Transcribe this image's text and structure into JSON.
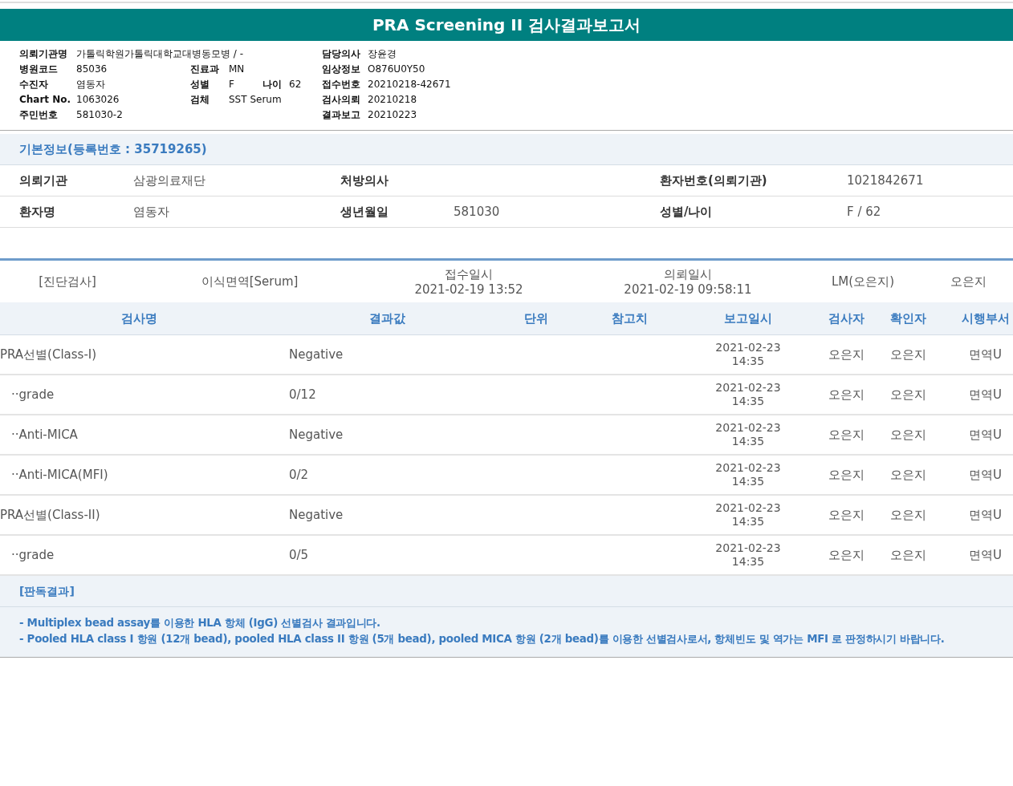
{
  "title": "PRA Screening II 검사결과보고서",
  "header_info": [
    {
      "col1": {
        "label": "의뢰기관명",
        "value": "가톨릭학원가톨릭대학교대병동모병 / -"
      },
      "col4": {
        "label": "담당의사",
        "value": "장윤경"
      }
    },
    {
      "col1": {
        "label": "병원코드",
        "value": "85036"
      },
      "col2": {
        "label": "진료과",
        "value": "MN"
      },
      "col4": {
        "label": "임상정보",
        "value": "O876U0Y50"
      }
    },
    {
      "col1": {
        "label": "수진자",
        "value": "염동자"
      },
      "col2": {
        "label": "성별",
        "value": "F"
      },
      "col3": {
        "label": "나이",
        "value": "62"
      },
      "col4": {
        "label": "접수번호",
        "value": "20210218-42671"
      }
    },
    {
      "col1": {
        "label": "Chart No.",
        "value": "1063026"
      },
      "col2": {
        "label": "검체",
        "value": "SST Serum"
      },
      "col4": {
        "label": "검사의뢰",
        "value": "20210218"
      }
    },
    {
      "col1": {
        "label": "주민번호",
        "value": "581030-2"
      },
      "col4": {
        "label": "결과보고",
        "value": "20210223"
      }
    }
  ],
  "basic_info": {
    "title": "기본정보(등록번호 : 35719265)",
    "rows": [
      [
        {
          "label": "의뢰기관",
          "value": "삼광의료재단"
        },
        {
          "label": "처방의사"
        },
        {
          "label": "환자번호(의뢰기관)",
          "value": "1021842671"
        }
      ],
      [
        {
          "label": "환자명",
          "value": "염동자"
        },
        {
          "label": "생년월일",
          "value": "581030"
        },
        {
          "label": "성별/나이",
          "value": "F / 62"
        }
      ]
    ]
  },
  "order": {
    "category": "[진단검사]",
    "department": "이식면역[Serum]",
    "received_label": "접수일시",
    "received": "2021-02-19 13:52",
    "requested_label": "의뢰일시",
    "requested": "2021-02-19 09:58:11",
    "lab": "LM(오은지)",
    "person": "오은지"
  },
  "results": {
    "columns": [
      "검사명",
      "결과값",
      "단위",
      "참고치",
      "보고일시",
      "검사자",
      "확인자",
      "시행부서"
    ],
    "rows": [
      {
        "name": "PRA선별(Class-I)",
        "result": "Negative",
        "reported": "2021-02-23\n14:35",
        "tester": "오은지",
        "confirmer": "오은지",
        "dept": "면역U",
        "children": [
          {
            "name": "··grade",
            "result": "0/12",
            "reported": "2021-02-23\n14:35",
            "tester": "오은지",
            "confirmer": "오은지",
            "dept": "면역U"
          },
          {
            "name": "··Anti-MICA",
            "result": "Negative",
            "reported": "2021-02-23\n14:35",
            "tester": "오은지",
            "confirmer": "오은지",
            "dept": "면역U"
          },
          {
            "name": "··Anti-MICA(MFI)",
            "result": "0/2",
            "reported": "2021-02-23\n14:35",
            "tester": "오은지",
            "confirmer": "오은지",
            "dept": "면역U"
          }
        ]
      },
      {
        "name": "PRA선별(Class-II)",
        "result": "Negative",
        "reported": "2021-02-23\n14:35",
        "tester": "오은지",
        "confirmer": "오은지",
        "dept": "면역U",
        "children": [
          {
            "name": "··grade",
            "result": "0/5",
            "reported": "2021-02-23\n14:35",
            "tester": "오은지",
            "confirmer": "오은지",
            "dept": "면역U"
          }
        ]
      }
    ]
  },
  "interpretation": {
    "title": "[판독결과]",
    "lines": [
      "- Multiplex bead assay를 이용한 HLA 항체 (IgG) 선별검사 결과입니다.",
      "- Pooled HLA class I 항원 (12개 bead), pooled HLA class II 항원 (5개 bead), pooled MICA 항원 (2개 bead)를 이용한 선별검사로서, 항체빈도 및 역가는 MFI 로 판정하시기 바랍니다."
    ]
  }
}
